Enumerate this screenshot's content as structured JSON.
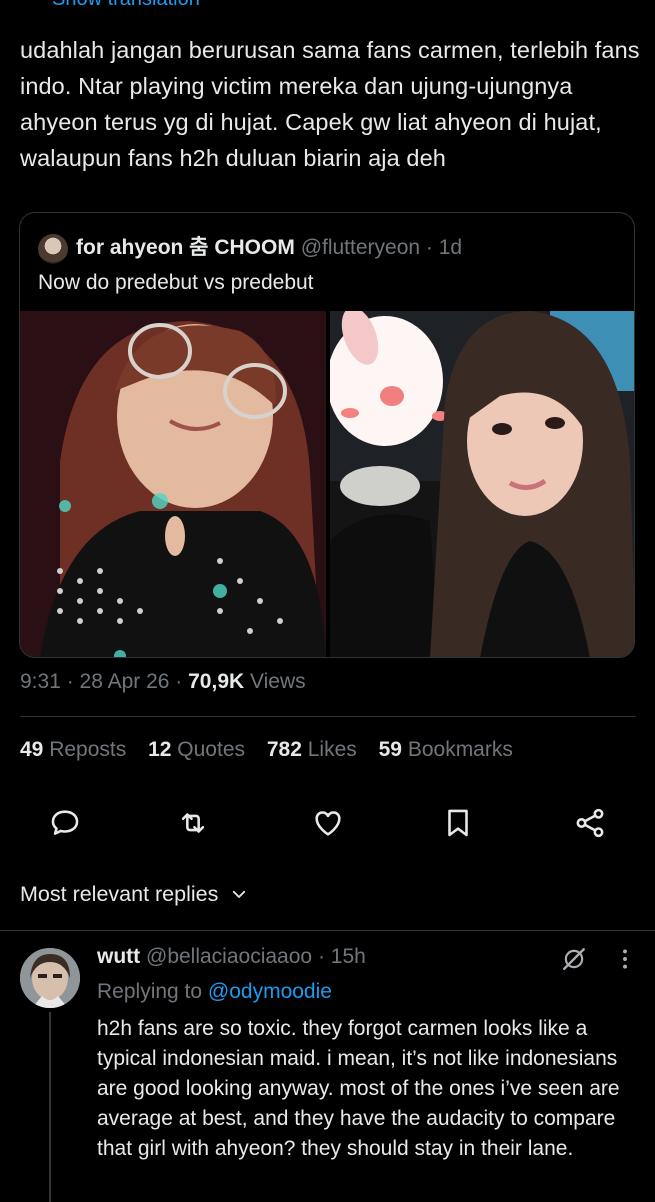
{
  "tweet": {
    "show_translation": "Show translation",
    "text": "udahlah jangan berurusan sama fans carmen, terlebih fans indo. Ntar playing victim mereka dan ujung-ujungnya ahyeon terus yg di hujat. Capek gw liat ahyeon di hujat, walaupun fans h2h duluan biarin aja deh"
  },
  "quote": {
    "name": "for ahyeon 춤 CHOOM",
    "handle": "@flutteryeon",
    "time": "· 1d",
    "text": "Now do predebut vs predebut"
  },
  "meta": {
    "time": "9:31",
    "date": "28 Apr 26",
    "views_count": "70,9K",
    "views_label": "Views"
  },
  "stats": [
    {
      "count": "49",
      "label": "Reposts"
    },
    {
      "count": "12",
      "label": "Quotes"
    },
    {
      "count": "782",
      "label": "Likes"
    },
    {
      "count": "59",
      "label": "Bookmarks"
    }
  ],
  "actions": [
    "reply-icon",
    "repost-icon",
    "like-icon",
    "bookmark-icon",
    "share-icon"
  ],
  "replies_filter": "Most relevant replies",
  "reply": {
    "name": "wutt",
    "handle": "@bellaciaociaaoo",
    "time": "· 15h",
    "replying_to_label": "Replying to",
    "replying_to_handle": "@odymoodie",
    "text": "h2h fans are so toxic. they forgot carmen looks like a typical indonesian maid. i mean, it’s not like indonesians are good looking anyway. most of the ones i’ve seen are average at best, and they have the audacity to compare that girl with ahyeon? they should stay in their lane."
  },
  "colors": {
    "background": "#000000",
    "text": "#e7e9ea",
    "muted": "#71767b",
    "link": "#1d9bf0",
    "border": "#2f3336"
  }
}
